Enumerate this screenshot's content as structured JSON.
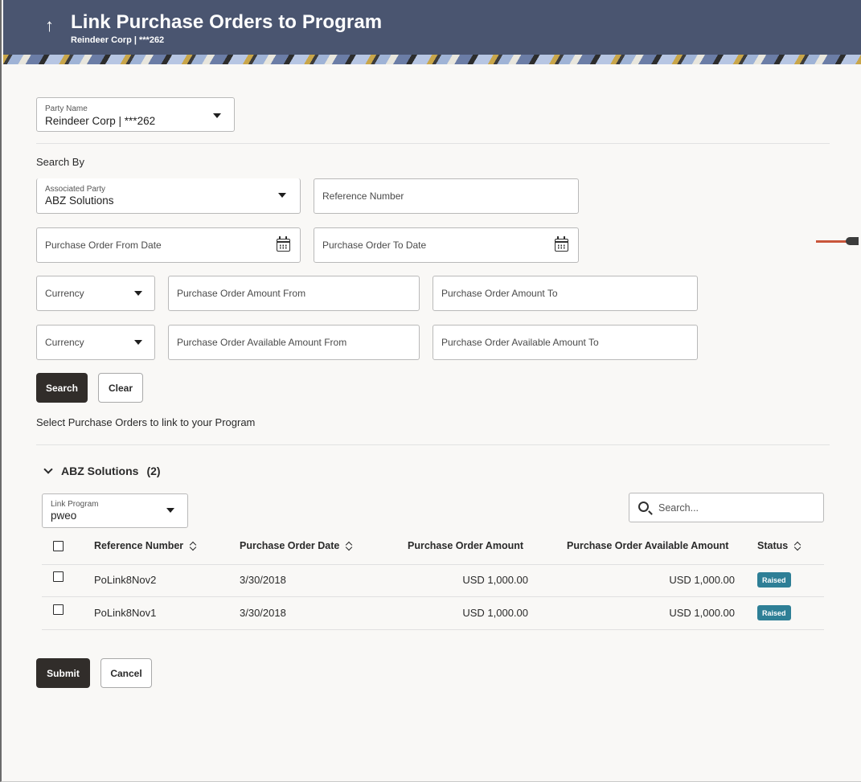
{
  "header": {
    "back_glyph": "↑",
    "title": "Link Purchase Orders to Program",
    "subtitle": "Reindeer Corp | ***262"
  },
  "party": {
    "label": "Party Name",
    "value": "Reindeer Corp | ***262"
  },
  "search_by": {
    "label": "Search By",
    "associated_party": {
      "label": "Associated Party",
      "value": "ABZ Solutions"
    },
    "reference_number": {
      "placeholder": "Reference Number"
    },
    "from_date": {
      "placeholder": "Purchase Order From Date"
    },
    "to_date": {
      "placeholder": "Purchase Order To Date"
    },
    "currency_1": {
      "placeholder": "Currency"
    },
    "amount_from": {
      "placeholder": "Purchase Order Amount From"
    },
    "amount_to": {
      "placeholder": "Purchase Order Amount To"
    },
    "currency_2": {
      "placeholder": "Currency"
    },
    "available_from": {
      "placeholder": "Purchase Order Available Amount From"
    },
    "available_to": {
      "placeholder": "Purchase Order Available Amount To"
    },
    "search_label": "Search",
    "clear_label": "Clear"
  },
  "select_label": "Select Purchase Orders to link to your Program",
  "group": {
    "name": "ABZ Solutions",
    "count": "(2)",
    "link_program": {
      "label": "Link Program",
      "value": "pweo"
    },
    "search_placeholder": "Search..."
  },
  "table": {
    "columns": [
      "Reference Number",
      "Purchase Order Date",
      "Purchase Order Amount",
      "Purchase Order Available Amount",
      "Status"
    ],
    "rows": [
      {
        "ref": "PoLink8Nov2",
        "date": "3/30/2018",
        "amount": "USD 1,000.00",
        "available": "USD 1,000.00",
        "status": "Raised"
      },
      {
        "ref": "PoLink8Nov1",
        "date": "3/30/2018",
        "amount": "USD 1,000.00",
        "available": "USD 1,000.00",
        "status": "Raised"
      }
    ]
  },
  "actions": {
    "submit_label": "Submit",
    "cancel_label": "Cancel"
  },
  "colors": {
    "header_bg": "#4a5570",
    "primary_button": "#312d2a",
    "status_badge": "#2e7f96"
  }
}
